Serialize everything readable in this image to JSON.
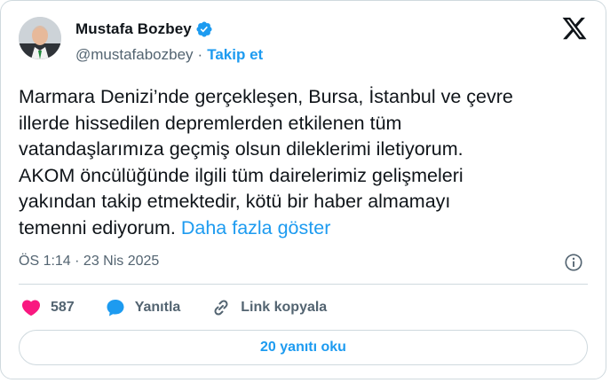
{
  "author": {
    "name": "Mustafa Bozbey",
    "handle": "@mustafabozbey",
    "separator": "·",
    "follow_label": "Takip et"
  },
  "tweet": {
    "text": "Marmara Denizi’nde gerçekleşen, Bursa, İstanbul ve çevre\nillerde hissedilen depremlerden etkilenen tüm\nvatandaşlarımıza geçmiş olsun dileklerimi iletiyorum.\nAKOM öncülüğünde ilgili tüm dairelerimiz gelişmeleri\nyakından takip etmektedir, kötü bir haber almamayı\ntemenni ediyorum. ",
    "show_more": "Daha fazla göster",
    "timestamp": "ÖS 1:14 · 23 Nis 2025"
  },
  "actions": {
    "like_count": "587",
    "reply_label": "Yanıtla",
    "copy_link_label": "Link kopyala"
  },
  "footer": {
    "read_replies_label": "20 yanıtı oku"
  },
  "colors": {
    "accent": "#1d9bf0",
    "like": "#f91880",
    "secondary_text": "#536471",
    "border": "#cfd9de"
  },
  "icons": [
    "verified-badge-icon",
    "x-logo-icon",
    "info-icon",
    "heart-icon",
    "reply-bubble-icon",
    "link-icon"
  ]
}
